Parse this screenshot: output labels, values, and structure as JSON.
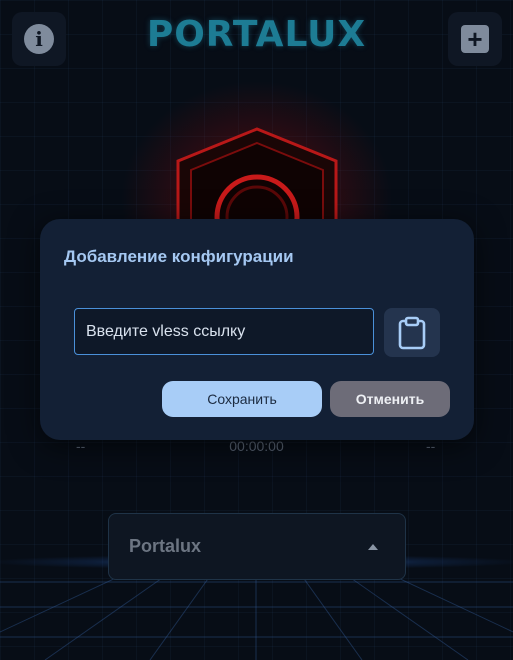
{
  "app": {
    "logo_text": "PORTALUX"
  },
  "header": {
    "info_icon": "info-icon",
    "add_icon": "plus-icon",
    "info_glyph": "i",
    "add_glyph": "+"
  },
  "status": {
    "left_value": "--",
    "timer": "00:00:00",
    "right_value": "--",
    "shield_color": "#c01818"
  },
  "server_selector": {
    "selected": "Portalux",
    "icon": "caret-up-icon"
  },
  "dialog": {
    "title": "Добавление конфигурации",
    "input_placeholder": "Введите vless ссылку",
    "input_value": "",
    "paste_icon": "clipboard-icon",
    "save_label": "Сохранить",
    "cancel_label": "Отменить"
  },
  "colors": {
    "accent": "#a8cdf7",
    "input_border": "#4a90d9",
    "dialog_bg": "#132035",
    "cancel_bg": "#6d6c78"
  }
}
